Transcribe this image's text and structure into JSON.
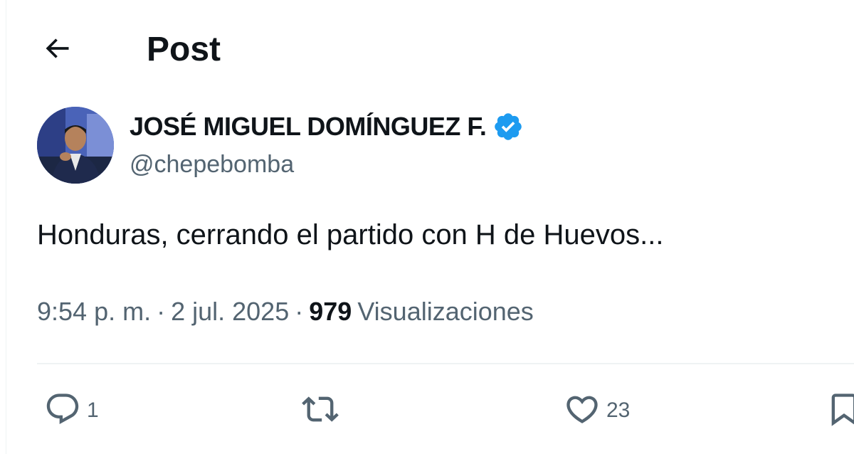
{
  "header": {
    "title": "Post",
    "back_icon": "arrow-left-icon"
  },
  "author": {
    "name": "JOSÉ MIGUEL DOMÍNGUEZ F.",
    "handle": "@chepebomba",
    "verified_icon": "verified-badge-icon",
    "verified_color": "#1d9bf0"
  },
  "post": {
    "text": "Honduras, cerrando el partido con H de Huevos..."
  },
  "meta": {
    "time": "9:54 p. m.",
    "separator": "·",
    "date": "2 jul. 2025",
    "views_count": "979",
    "views_label": "Visualizaciones"
  },
  "actions": {
    "reply_count": "1",
    "repost_count": "",
    "like_count": "23",
    "icons": [
      "reply-icon",
      "repost-icon",
      "like-icon",
      "bookmark-icon"
    ]
  },
  "colors": {
    "text_primary": "#0f1419",
    "text_secondary": "#536471",
    "divider": "#eff3f4",
    "accent": "#1d9bf0"
  }
}
